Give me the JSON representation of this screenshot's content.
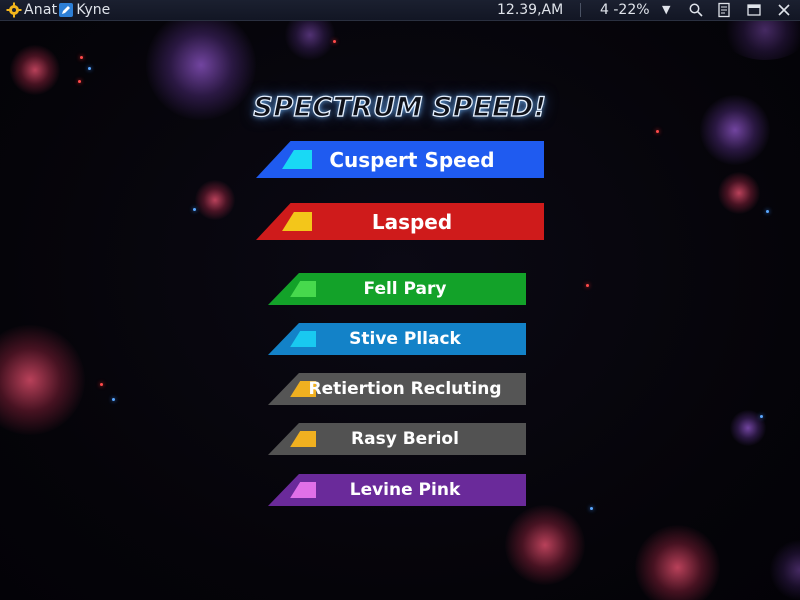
{
  "topbar": {
    "app_title": "Anat",
    "app_title_suffix": "Kyne",
    "clock": "12.39,AM",
    "battery": "4 -22%",
    "dropdown_icon": "chevron-down-icon",
    "icons": [
      "gear-icon",
      "pencil-icon",
      "search-icon",
      "document-icon",
      "window-icon",
      "close-icon"
    ]
  },
  "title": "SPECTRUM SPEED!",
  "menu": {
    "items": [
      {
        "label": "Cuspert Speed",
        "color": "#1f5bf0",
        "accent": "#19d9f5",
        "size": "large"
      },
      {
        "label": "Lasped",
        "color": "#cf1b1b",
        "accent": "#f3c61a",
        "size": "large"
      },
      {
        "label": "Fell Pary",
        "color": "#13a229",
        "accent": "#47d94d",
        "size": "small"
      },
      {
        "label": "Stive Pllack",
        "color": "#1382c8",
        "accent": "#19c9f0",
        "size": "small"
      },
      {
        "label": "Retiertion Recluting",
        "color": "#555555",
        "accent": "#f0b020",
        "size": "small"
      },
      {
        "label": "Rasy Beriol",
        "color": "#525252",
        "accent": "#f0b020",
        "size": "small"
      },
      {
        "label": "Levine Pink",
        "color": "#6a2a9a",
        "accent": "#e070e8",
        "size": "small"
      }
    ]
  }
}
